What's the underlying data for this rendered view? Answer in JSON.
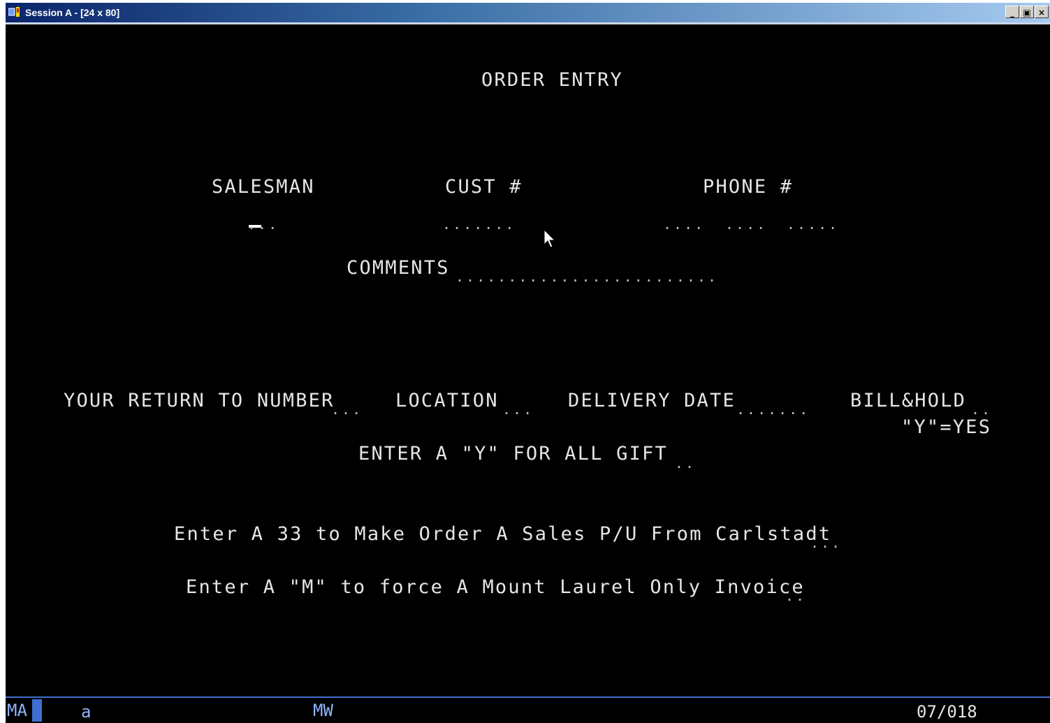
{
  "window": {
    "title": "Session A - [24 x 80]",
    "buttons": {
      "minimize": "_",
      "restore": "▣",
      "close": "×"
    }
  },
  "screen": {
    "heading": "ORDER ENTRY",
    "salesman_label": "SALESMAN",
    "cust_label": "CUST #",
    "phone_label": "PHONE #",
    "salesman_field": "...",
    "cust_field": ".......",
    "phone_field_1": "....",
    "phone_field_2": "....",
    "phone_field_3": ".....",
    "comments_label": "COMMENTS",
    "comments_field": ".........................",
    "return_label": "YOUR RETURN TO NUMBER",
    "return_field": "...",
    "location_label": "LOCATION",
    "location_field": "...",
    "delivery_label": "DELIVERY DATE",
    "delivery_field": ".......",
    "billhold_label": "BILL&HOLD",
    "billhold_field": "..",
    "billhold_hint": "\"Y\"=YES",
    "gift_label": "ENTER A \"Y\" FOR ALL GIFT",
    "gift_field": "..",
    "carlstadt_label": "Enter A 33 to Make Order A Sales P/U From Carlstadt",
    "carlstadt_field": "...",
    "mountlaurel_label": "Enter A \"M\" to force A Mount Laurel Only Invoice",
    "mountlaurel_field": ".."
  },
  "oia": {
    "session_indicator": "MA",
    "mode": "a",
    "workstation": "MW",
    "cursor_position": "07/018"
  },
  "colors": {
    "screen_bg": "#000000",
    "text": "#e6e6e6",
    "oia_text": "#8fb3ff",
    "oia_line": "#3f6fd0"
  }
}
